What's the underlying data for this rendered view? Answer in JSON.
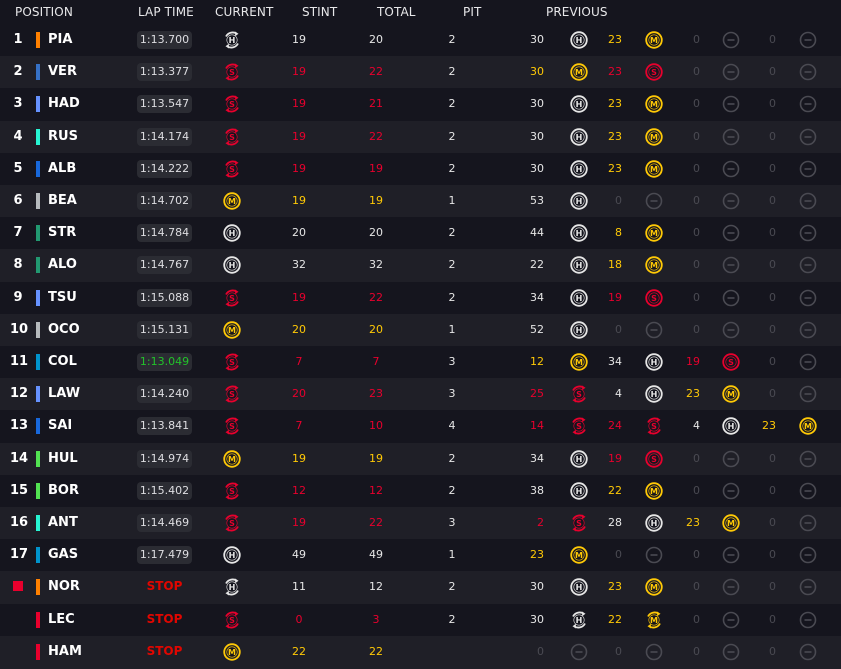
{
  "headers": {
    "position": "POSITION",
    "lap_time": "LAP TIME",
    "current": "CURRENT",
    "stint": "STINT",
    "total": "TOTAL",
    "pit": "PIT",
    "previous": "PREVIOUS"
  },
  "colors": {
    "red": "#e8002d",
    "yellow": "#ffc906",
    "white": "#e6e6e6",
    "dim": "#4a4a52",
    "best_lap": "#22c22a"
  },
  "rows": [
    {
      "pos": "1",
      "color": "#ff8000",
      "code": "PIA",
      "lap": "1:13.700",
      "current": {
        "c": "H",
        "swap": true
      },
      "stint": "19",
      "total": "20",
      "pit": "2",
      "prev": [
        {
          "n": "30",
          "c": "H"
        },
        {
          "n": "23",
          "c": "M"
        },
        {
          "n": "0",
          "c": "-"
        },
        {
          "n": "0",
          "c": "-"
        }
      ]
    },
    {
      "pos": "2",
      "color": "#3671c6",
      "code": "VER",
      "lap": "1:13.377",
      "current": {
        "c": "S",
        "swap": true
      },
      "stint": "19",
      "total": "22",
      "pit": "2",
      "prev": [
        {
          "n": "30",
          "c": "M"
        },
        {
          "n": "23",
          "c": "S"
        },
        {
          "n": "0",
          "c": "-"
        },
        {
          "n": "0",
          "c": "-"
        }
      ]
    },
    {
      "pos": "3",
      "color": "#6692ff",
      "code": "HAD",
      "lap": "1:13.547",
      "current": {
        "c": "S",
        "swap": true
      },
      "stint": "19",
      "total": "21",
      "pit": "2",
      "prev": [
        {
          "n": "30",
          "c": "H"
        },
        {
          "n": "23",
          "c": "M"
        },
        {
          "n": "0",
          "c": "-"
        },
        {
          "n": "0",
          "c": "-"
        }
      ]
    },
    {
      "pos": "4",
      "color": "#27f4d2",
      "code": "RUS",
      "lap": "1:14.174",
      "current": {
        "c": "S",
        "swap": true
      },
      "stint": "19",
      "total": "22",
      "pit": "2",
      "prev": [
        {
          "n": "30",
          "c": "H"
        },
        {
          "n": "23",
          "c": "M"
        },
        {
          "n": "0",
          "c": "-"
        },
        {
          "n": "0",
          "c": "-"
        }
      ]
    },
    {
      "pos": "5",
      "color": "#1868db",
      "code": "ALB",
      "lap": "1:14.222",
      "current": {
        "c": "S",
        "swap": true
      },
      "stint": "19",
      "total": "19",
      "pit": "2",
      "prev": [
        {
          "n": "30",
          "c": "H"
        },
        {
          "n": "23",
          "c": "M"
        },
        {
          "n": "0",
          "c": "-"
        },
        {
          "n": "0",
          "c": "-"
        }
      ]
    },
    {
      "pos": "6",
      "color": "#b6babd",
      "code": "BEA",
      "lap": "1:14.702",
      "current": {
        "c": "M",
        "swap": false
      },
      "stint": "19",
      "total": "19",
      "pit": "1",
      "prev": [
        {
          "n": "53",
          "c": "H"
        },
        {
          "n": "0",
          "c": "-"
        },
        {
          "n": "0",
          "c": "-"
        },
        {
          "n": "0",
          "c": "-"
        }
      ]
    },
    {
      "pos": "7",
      "color": "#229971",
      "code": "STR",
      "lap": "1:14.784",
      "current": {
        "c": "H",
        "swap": false
      },
      "stint": "20",
      "total": "20",
      "pit": "2",
      "prev": [
        {
          "n": "44",
          "c": "H"
        },
        {
          "n": "8",
          "c": "M"
        },
        {
          "n": "0",
          "c": "-"
        },
        {
          "n": "0",
          "c": "-"
        }
      ]
    },
    {
      "pos": "8",
      "color": "#229971",
      "code": "ALO",
      "lap": "1:14.767",
      "current": {
        "c": "H",
        "swap": false
      },
      "stint": "32",
      "total": "32",
      "pit": "2",
      "prev": [
        {
          "n": "22",
          "c": "H"
        },
        {
          "n": "18",
          "c": "M"
        },
        {
          "n": "0",
          "c": "-"
        },
        {
          "n": "0",
          "c": "-"
        }
      ]
    },
    {
      "pos": "9",
      "color": "#6692ff",
      "code": "TSU",
      "lap": "1:15.088",
      "current": {
        "c": "S",
        "swap": true
      },
      "stint": "19",
      "total": "22",
      "pit": "2",
      "prev": [
        {
          "n": "34",
          "c": "H"
        },
        {
          "n": "19",
          "c": "S"
        },
        {
          "n": "0",
          "c": "-"
        },
        {
          "n": "0",
          "c": "-"
        }
      ]
    },
    {
      "pos": "10",
      "color": "#b6babd",
      "code": "OCO",
      "lap": "1:15.131",
      "current": {
        "c": "M",
        "swap": false
      },
      "stint": "20",
      "total": "20",
      "pit": "1",
      "prev": [
        {
          "n": "52",
          "c": "H"
        },
        {
          "n": "0",
          "c": "-"
        },
        {
          "n": "0",
          "c": "-"
        },
        {
          "n": "0",
          "c": "-"
        }
      ]
    },
    {
      "pos": "11",
      "color": "#0093cc",
      "code": "COL",
      "lap": "1:13.049",
      "best": true,
      "current": {
        "c": "S",
        "swap": true
      },
      "stint": "7",
      "total": "7",
      "pit": "3",
      "prev": [
        {
          "n": "12",
          "c": "M"
        },
        {
          "n": "34",
          "c": "H"
        },
        {
          "n": "19",
          "c": "S"
        },
        {
          "n": "0",
          "c": "-"
        }
      ]
    },
    {
      "pos": "12",
      "color": "#6692ff",
      "code": "LAW",
      "lap": "1:14.240",
      "current": {
        "c": "S",
        "swap": true
      },
      "stint": "20",
      "total": "23",
      "pit": "3",
      "prev": [
        {
          "n": "25",
          "c": "S",
          "swap": true
        },
        {
          "n": "4",
          "c": "H"
        },
        {
          "n": "23",
          "c": "M"
        },
        {
          "n": "0",
          "c": "-"
        }
      ]
    },
    {
      "pos": "13",
      "color": "#1868db",
      "code": "SAI",
      "lap": "1:13.841",
      "current": {
        "c": "S",
        "swap": true
      },
      "stint": "7",
      "total": "10",
      "pit": "4",
      "prev": [
        {
          "n": "14",
          "c": "S",
          "swap": true
        },
        {
          "n": "24",
          "c": "S",
          "swap": true
        },
        {
          "n": "4",
          "c": "H"
        },
        {
          "n": "23",
          "c": "M"
        }
      ]
    },
    {
      "pos": "14",
      "color": "#52e252",
      "code": "HUL",
      "lap": "1:14.974",
      "current": {
        "c": "M",
        "swap": false
      },
      "stint": "19",
      "total": "19",
      "pit": "2",
      "prev": [
        {
          "n": "34",
          "c": "H"
        },
        {
          "n": "19",
          "c": "S"
        },
        {
          "n": "0",
          "c": "-"
        },
        {
          "n": "0",
          "c": "-"
        }
      ]
    },
    {
      "pos": "15",
      "color": "#52e252",
      "code": "BOR",
      "lap": "1:15.402",
      "current": {
        "c": "S",
        "swap": true
      },
      "stint": "12",
      "total": "12",
      "pit": "2",
      "prev": [
        {
          "n": "38",
          "c": "H"
        },
        {
          "n": "22",
          "c": "M"
        },
        {
          "n": "0",
          "c": "-"
        },
        {
          "n": "0",
          "c": "-"
        }
      ]
    },
    {
      "pos": "16",
      "color": "#27f4d2",
      "code": "ANT",
      "lap": "1:14.469",
      "current": {
        "c": "S",
        "swap": true
      },
      "stint": "19",
      "total": "22",
      "pit": "3",
      "prev": [
        {
          "n": "2",
          "c": "S",
          "swap": true
        },
        {
          "n": "28",
          "c": "H"
        },
        {
          "n": "23",
          "c": "M"
        },
        {
          "n": "0",
          "c": "-"
        }
      ]
    },
    {
      "pos": "17",
      "color": "#0093cc",
      "code": "GAS",
      "lap": "1:17.479",
      "current": {
        "c": "H",
        "swap": false
      },
      "stint": "49",
      "total": "49",
      "pit": "1",
      "prev": [
        {
          "n": "23",
          "c": "M"
        },
        {
          "n": "0",
          "c": "-"
        },
        {
          "n": "0",
          "c": "-"
        },
        {
          "n": "0",
          "c": "-"
        }
      ]
    },
    {
      "pos": "",
      "stopped_square": true,
      "color": "#ff8000",
      "code": "NOR",
      "stop": "STOP",
      "current": {
        "c": "H",
        "swap": true
      },
      "stint": "11",
      "total": "12",
      "pit": "2",
      "prev": [
        {
          "n": "30",
          "c": "H"
        },
        {
          "n": "23",
          "c": "M"
        },
        {
          "n": "0",
          "c": "-"
        },
        {
          "n": "0",
          "c": "-"
        }
      ]
    },
    {
      "pos": "",
      "color": "#e8002d",
      "code": "LEC",
      "stop": "STOP",
      "current": {
        "c": "S",
        "swap": true
      },
      "stint": "0",
      "total": "3",
      "pit": "2",
      "prev": [
        {
          "n": "30",
          "c": "H",
          "swap": true
        },
        {
          "n": "22",
          "c": "M",
          "swap": true
        },
        {
          "n": "0",
          "c": "-"
        },
        {
          "n": "0",
          "c": "-"
        }
      ]
    },
    {
      "pos": "",
      "color": "#e8002d",
      "code": "HAM",
      "stop": "STOP",
      "current": {
        "c": "M",
        "swap": false
      },
      "stint": "22",
      "total": "22",
      "pit": "",
      "prev": [
        {
          "n": "0",
          "c": "-"
        },
        {
          "n": "0",
          "c": "-"
        },
        {
          "n": "0",
          "c": "-"
        },
        {
          "n": "0",
          "c": "-"
        }
      ]
    }
  ]
}
